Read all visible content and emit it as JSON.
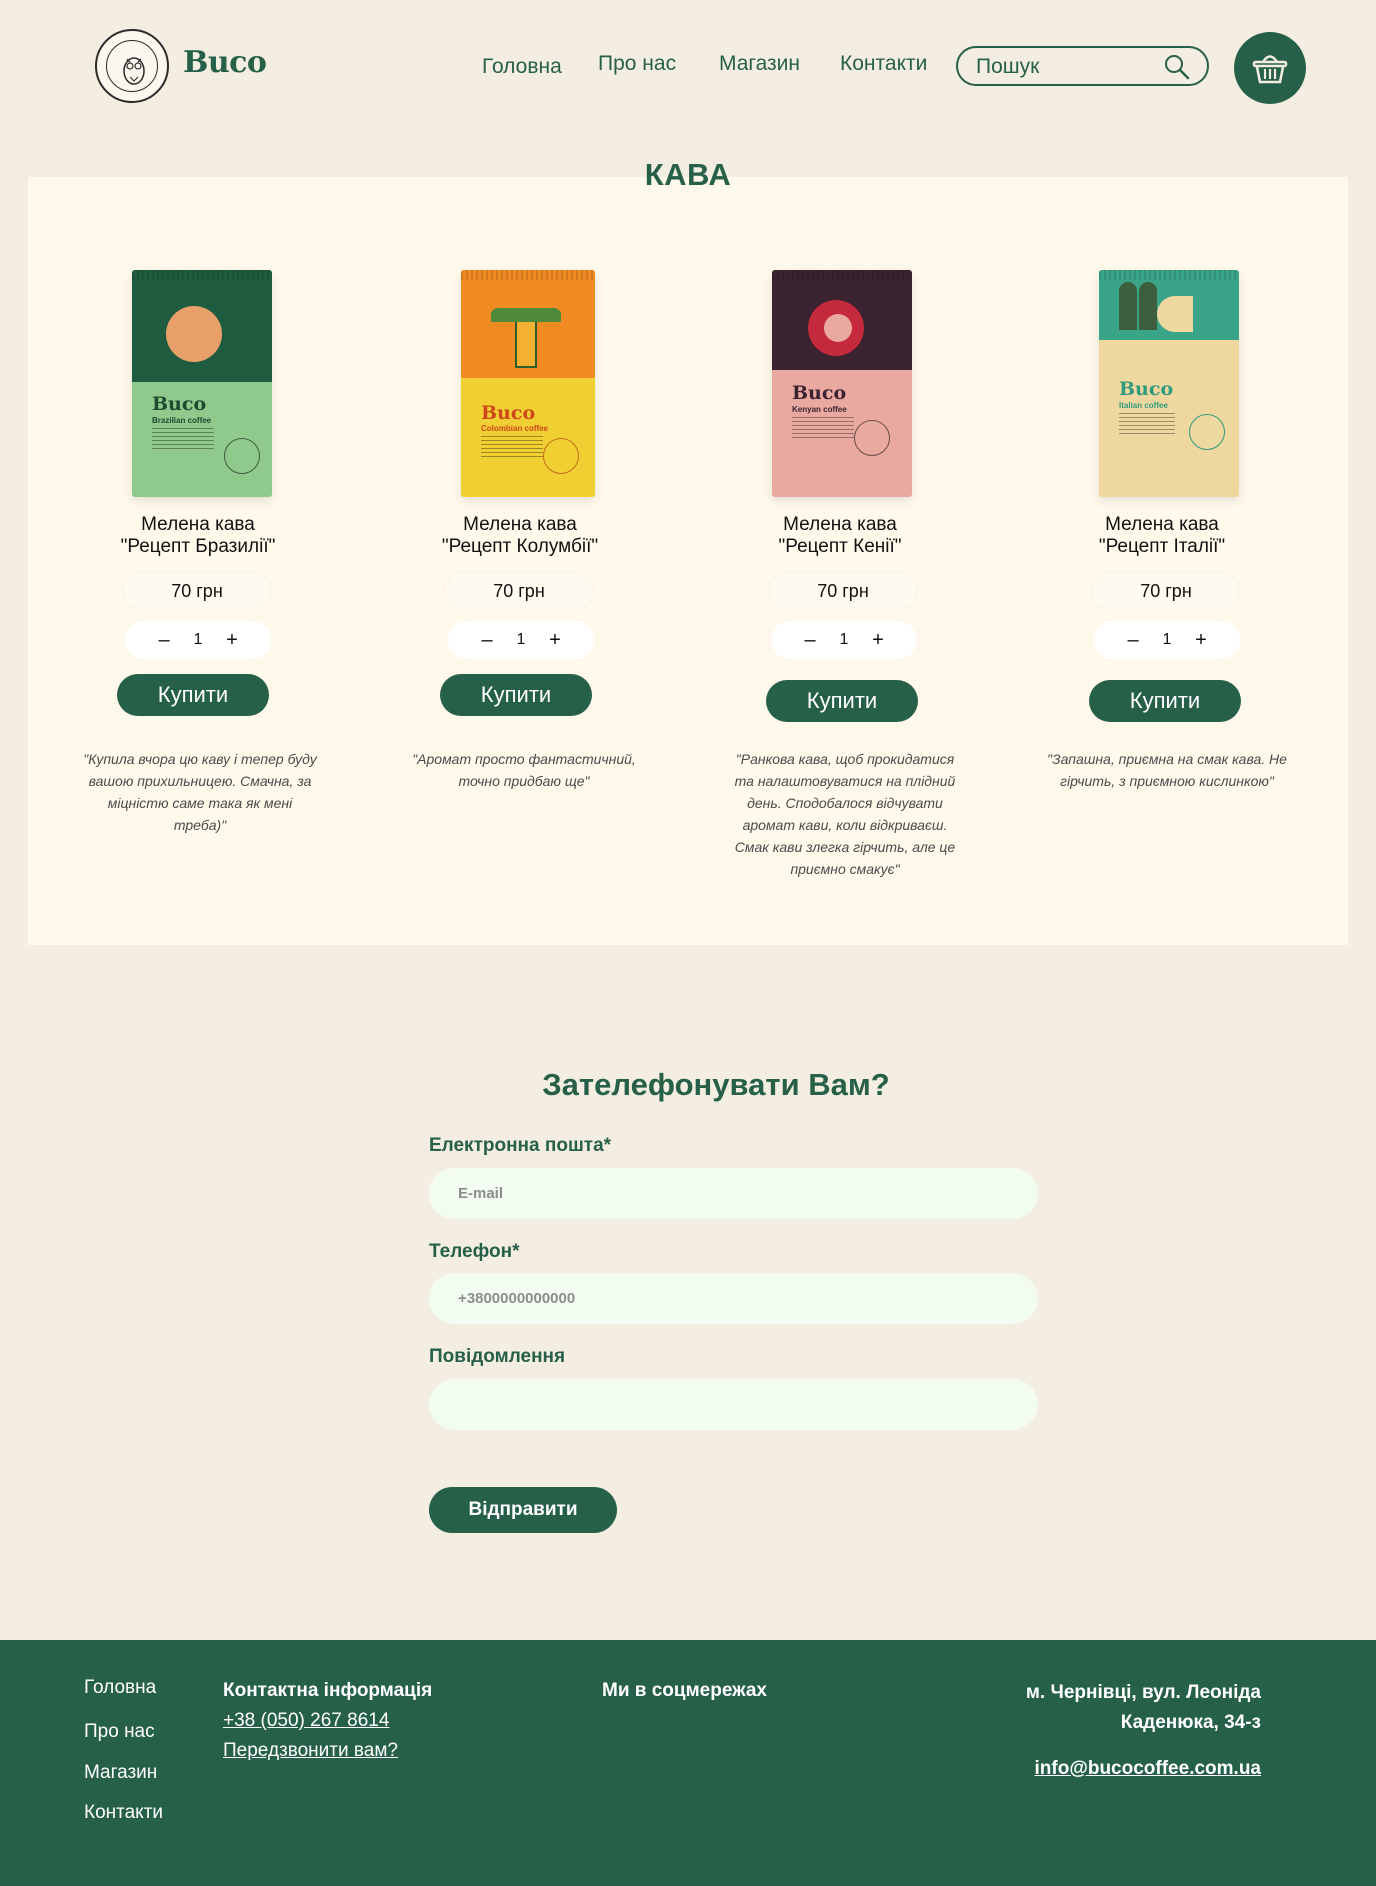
{
  "header": {
    "brand": "Buco",
    "nav": [
      "Головна",
      "Про нас",
      "Магазин",
      "Контакти"
    ],
    "search_placeholder": "Пошук"
  },
  "catalog": {
    "title": "КАВА",
    "products": [
      {
        "name_line1": "Мелена кава",
        "name_line2": "\"Рецепт Бразилії\"",
        "price": "70 грн",
        "qty": "1",
        "buy": "Купити",
        "review": "\"Купила вчора цю каву і тепер буду вашою прихильницею. Смачна, за міцністю саме така як мені треба)\"",
        "pack_brand": "Buco",
        "pack_sub": "Brazilian coffee"
      },
      {
        "name_line1": "Мелена кава",
        "name_line2": "\"Рецепт Колумбії\"",
        "price": "70 грн",
        "qty": "1",
        "buy": "Купити",
        "review": "\"Аромат просто фантастичний, точно придбаю ще\"",
        "pack_brand": "Buco",
        "pack_sub": "Colombian coffee"
      },
      {
        "name_line1": "Мелена кава",
        "name_line2": "\"Рецепт Кенії\"",
        "price": "70 грн",
        "qty": "1",
        "buy": "Купити",
        "review": "\"Ранкова кава, щоб прокидатися та налаштовуватися на плідний день. Сподобалося відчувати аромат кави, коли відкриваєш. Смак кави злегка гірчить, але це приємно смакує\"",
        "pack_brand": "Buco",
        "pack_sub": "Kenyan coffee"
      },
      {
        "name_line1": "Мелена кава",
        "name_line2": "\"Рецепт Італії\"",
        "price": "70 грн",
        "qty": "1",
        "buy": "Купити",
        "review": "\"Запашна, приємна на смак кава. Не гірчить, з приємною кислинкою\"",
        "pack_brand": "Buco",
        "pack_sub": "Italian coffee"
      }
    ]
  },
  "callback": {
    "title": "Зателефонувати Вам?",
    "email_label": "Електронна пошта*",
    "email_placeholder": "E-mail",
    "phone_label": "Телефон*",
    "phone_placeholder": "+3800000000000",
    "message_label": "Повідомлення",
    "submit": "Відправити"
  },
  "footer": {
    "nav": [
      "Головна",
      "Про нас",
      "Магазин",
      "Контакти"
    ],
    "contact_heading": "Контактна інформація",
    "phone": "+38 (050) 267 8614",
    "callback_link": "Передзвонити вам?",
    "social_heading": "Ми в соцмережах",
    "address": "м. Чернівці, вул. Леоніда Каденюка, 34-з",
    "email": "info@bucocoffee.com.ua"
  },
  "colors": {
    "brand_green": "#276049",
    "page_bg": "#f4eee2",
    "panel_bg": "#fff9ec",
    "input_bg": "#f3fcf1"
  }
}
